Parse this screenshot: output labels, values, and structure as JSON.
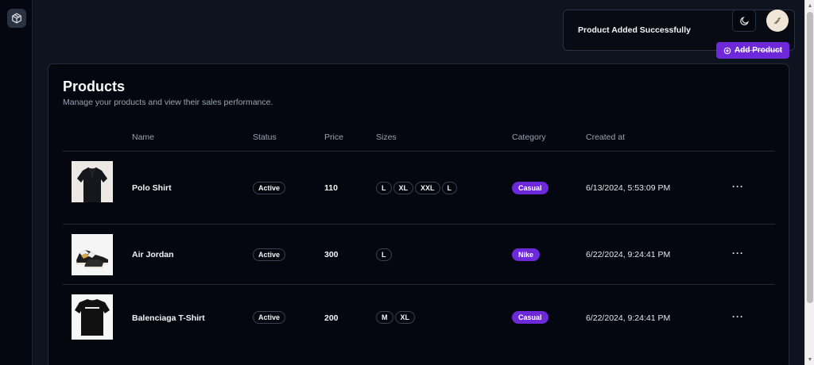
{
  "toast": {
    "message": "Product Added Successfully"
  },
  "header": {
    "add_product_label": "Add Product"
  },
  "products_card": {
    "title": "Products",
    "subtitle": "Manage your products and view their sales performance."
  },
  "table": {
    "columns": [
      "Name",
      "Status",
      "Price",
      "Sizes",
      "Category",
      "Created at"
    ],
    "rows": [
      {
        "name": "Polo Shirt",
        "status": "Active",
        "price": "110",
        "sizes": [
          "L",
          "XL",
          "XXL",
          "L"
        ],
        "category": "Casual",
        "created_at": "6/13/2024, 5:53:09 PM",
        "image": "polo-shirt-image"
      },
      {
        "name": "Air Jordan",
        "status": "Active",
        "price": "300",
        "sizes": [
          "L"
        ],
        "category": "Nike",
        "created_at": "6/22/2024, 9:24:41 PM",
        "image": "sneaker-image"
      },
      {
        "name": "Balenciaga T-Shirt",
        "status": "Active",
        "price": "200",
        "sizes": [
          "M",
          "XL"
        ],
        "category": "Casual",
        "created_at": "6/22/2024, 9:24:41 PM",
        "image": "t-shirt-image"
      }
    ],
    "row_action_icon": "more-horizontal-icon"
  },
  "icons": {
    "logo": "package-icon",
    "theme_toggle": "moon-icon",
    "add": "plus-circle-icon"
  },
  "colors": {
    "accent": "#6d28d9",
    "background": "#0e1320",
    "card": "#04070f"
  }
}
